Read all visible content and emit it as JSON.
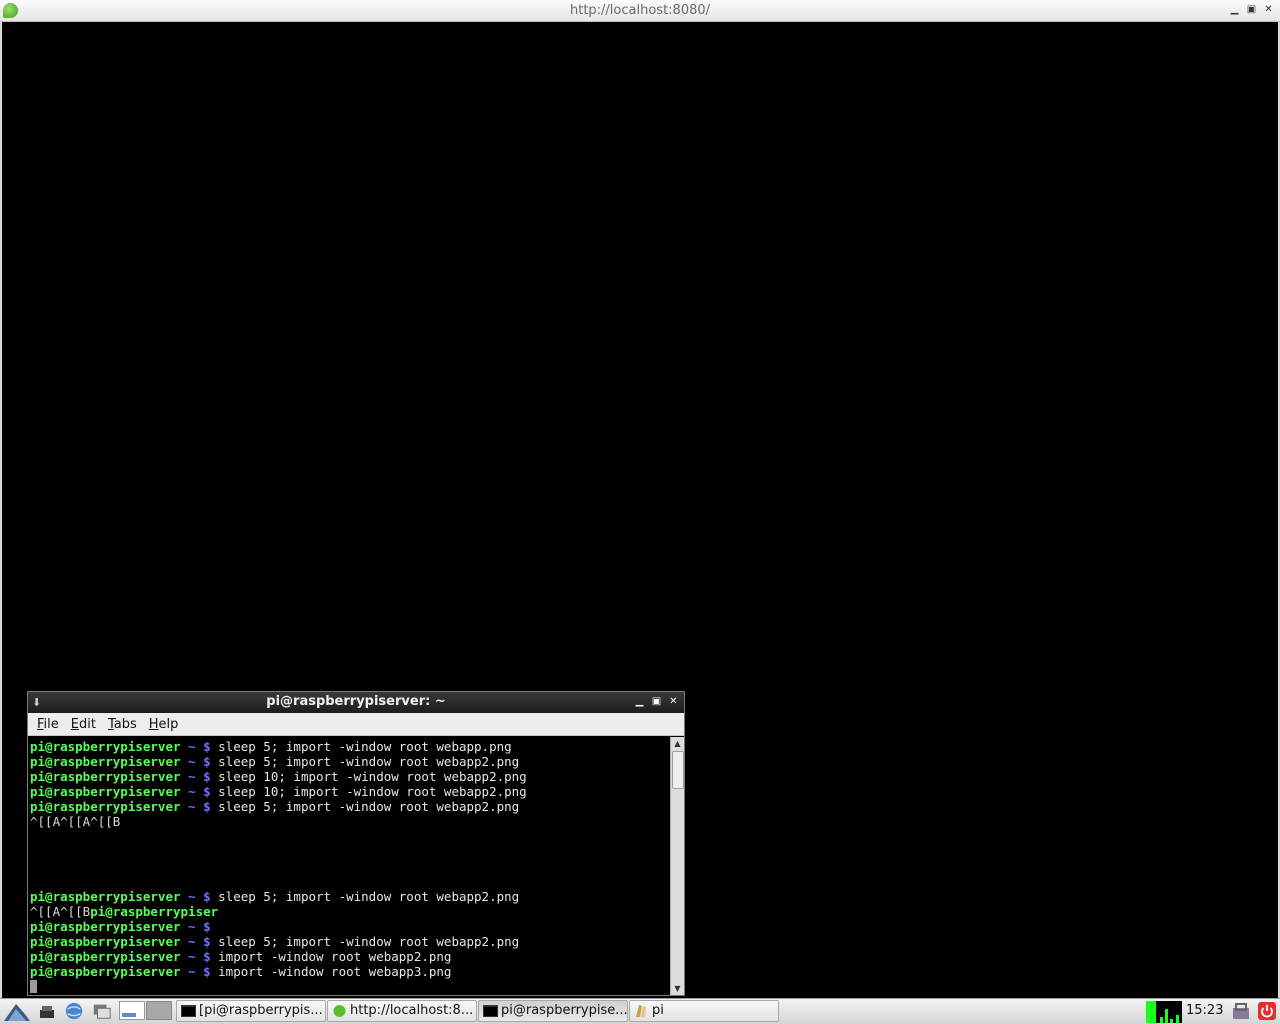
{
  "browser": {
    "title": "http://localhost:8080/"
  },
  "terminal": {
    "title": "pi@raspberrypiserver: ~",
    "menu": [
      "File",
      "Edit",
      "Tabs",
      "Help"
    ],
    "lines": [
      {
        "user": "pi@raspberrypiserver",
        "path": " ~ $ ",
        "cmd": "sleep 5; import -window root webapp.png"
      },
      {
        "user": "pi@raspberrypiserver",
        "path": " ~ $ ",
        "cmd": "sleep 5; import -window root webapp2.png"
      },
      {
        "user": "pi@raspberrypiserver",
        "path": " ~ $ ",
        "cmd": "sleep 10; import -window root webapp2.png"
      },
      {
        "user": "pi@raspberrypiserver",
        "path": " ~ $ ",
        "cmd": "sleep 10; import -window root webapp2.png"
      },
      {
        "user": "pi@raspberrypiserver",
        "path": " ~ $ ",
        "cmd": "sleep 5; import -window root webapp2.png"
      },
      {
        "raw": "^[[A^[[A^[[B"
      },
      {
        "raw": ""
      },
      {
        "raw": ""
      },
      {
        "raw": ""
      },
      {
        "raw": ""
      },
      {
        "user": "pi@raspberrypiserver",
        "path": " ~ $ ",
        "cmd": "sleep 5; import -window root webapp2.png"
      },
      {
        "raw": "^[[A^[[B",
        "user": "pi@raspberrypiser"
      },
      {
        "user": "pi@raspberrypiserver",
        "path": " ~ $",
        "cmd": ""
      },
      {
        "user": "pi@raspberrypiserver",
        "path": " ~ $ ",
        "cmd": "sleep 5; import -window root webapp2.png"
      },
      {
        "user": "pi@raspberrypiserver",
        "path": " ~ $ ",
        "cmd": "import -window root webapp2.png"
      },
      {
        "user": "pi@raspberrypiserver",
        "path": " ~ $ ",
        "cmd": "import -window root webapp3.png"
      }
    ]
  },
  "taskbar": {
    "tasks": [
      {
        "label": "[pi@raspberrypis...",
        "icon": "terminal-icon"
      },
      {
        "label": "http://localhost:8...",
        "icon": "browser-leaf-icon"
      },
      {
        "label": "pi@raspberrypise...",
        "icon": "terminal-icon"
      },
      {
        "label": "pi",
        "icon": "folder-icon"
      }
    ],
    "clock": "15:23"
  }
}
